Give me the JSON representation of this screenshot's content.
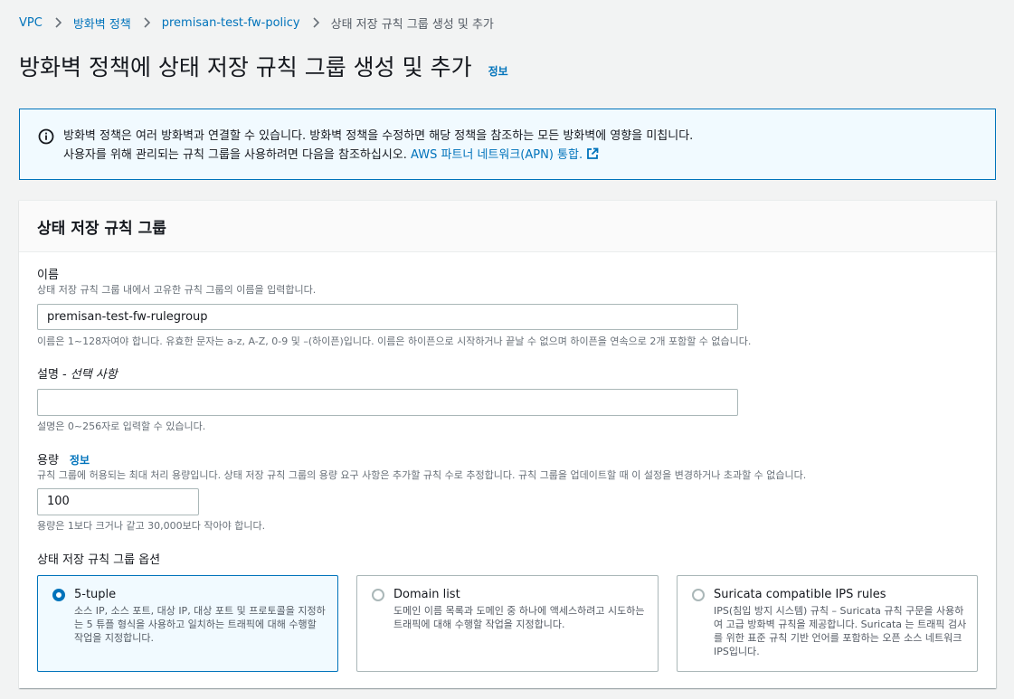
{
  "breadcrumb": {
    "items": [
      "VPC",
      "방화벽 정책",
      "premisan-test-fw-policy"
    ],
    "current": "상태 저장 규칙 그룹 생성 및 추가"
  },
  "page": {
    "title": "방화벽 정책에 상태 저장 규칙 그룹 생성 및 추가",
    "info_link": "정보"
  },
  "alert": {
    "line1": "방화벽 정책은 여러 방화벽과 연결할 수 있습니다. 방화벽 정책을 수정하면 해당 정책을 참조하는 모든 방화벽에 영향을 미칩니다.",
    "line2": "사용자를 위해 관리되는 규칙 그룹을 사용하려면 다음을 참조하십시오. ",
    "link": "AWS 파트너 네트워크(APN) 통합."
  },
  "panel": {
    "title": "상태 저장 규칙 그룹"
  },
  "form": {
    "name": {
      "label": "이름",
      "description": "상태 저장 규칙 그룹 내에서 고유한 규칙 그룹의 이름을 입력합니다.",
      "value": "premisan-test-fw-rulegroup",
      "hint": "이름은 1~128자여야 합니다. 유효한 문자는 a-z, A-Z, 0-9 및 –(하이픈)입니다. 이름은 하이픈으로 시작하거나 끝날 수 없으며 하이픈을 연속으로 2개 포함할 수 없습니다."
    },
    "description": {
      "label": "설명 -",
      "optional": "선택 사항",
      "value": "",
      "hint": "설명은 0~256자로 입력할 수 있습니다."
    },
    "capacity": {
      "label": "용량",
      "info": "정보",
      "description": "규칙 그룹에 허용되는 최대 처리 용량입니다. 상태 저장 규칙 그룹의 용량 요구 사항은 추가할 규칙 수로 추정합니다. 규칙 그룹을 업데이트할 때 이 설정을 변경하거나 초과할 수 없습니다.",
      "value": "100",
      "hint": "용량은 1보다 크거나 같고 30,000보다 작아야 합니다."
    },
    "options": {
      "label": "상태 저장 규칙 그룹 옵션",
      "selected": "5-tuple",
      "items": [
        {
          "title": "5-tuple",
          "desc": "소스 IP, 소스 포트, 대상 IP, 대상 포트 및 프로토콜을 지정하는 5 튜플 형식을 사용하고 일치하는 트래픽에 대해 수행할 작업을 지정합니다."
        },
        {
          "title": "Domain list",
          "desc": "도메인 이름 목록과 도메인 중 하나에 액세스하려고 시도하는 트래픽에 대해 수행할 작업을 지정합니다."
        },
        {
          "title": "Suricata compatible IPS rules",
          "desc": "IPS(침입 방지 시스템) 규칙 – Suricata 규칙 구문을 사용하여 고급 방화벽 규칙을 제공합니다. Suricata 는 트래픽 검사를 위한 표준 규칙 기반 언어를 포함하는 오픈 소스 네트워크 IPS입니다."
        }
      ]
    }
  },
  "colors": {
    "link": "#0073bb",
    "background": "#f2f3f3",
    "alert_bg": "#f1faff",
    "border": "#aab7b8"
  }
}
